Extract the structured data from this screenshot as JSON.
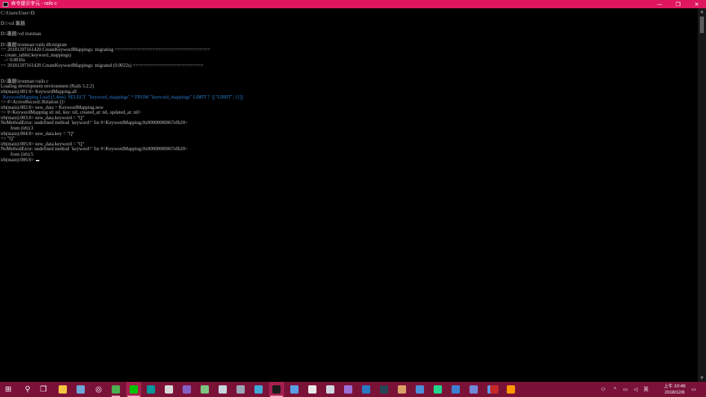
{
  "window": {
    "title": "命令提示字元 - rails  c",
    "controls": {
      "minimize": "—",
      "maximize": "❐",
      "close": "✕"
    }
  },
  "console": {
    "lines": [
      {
        "text": "C:\\Users\\User>D:"
      },
      {
        "text": ""
      },
      {
        "text": "D:\\>cd 專題"
      },
      {
        "text": ""
      },
      {
        "text": "D:\\專題>cd ironman"
      },
      {
        "text": ""
      },
      {
        "text": "D:\\專題\\ironman>rails db:migrate"
      },
      {
        "text": "== 20181207161420 CreateKeywordMappings: migrating ==================================="
      },
      {
        "text": "-- create_table(:keyword_mappings)"
      },
      {
        "text": "   -> 0.0016s"
      },
      {
        "text": "== 20181207161420 CreateKeywordMappings: migrated (0.0022s) =========================="
      },
      {
        "text": ""
      },
      {
        "text": ""
      },
      {
        "text": "D:\\專題\\ironman>rails c"
      },
      {
        "text": "Loading development environment (Rails 5.2.2)"
      },
      {
        "text": "irb(main):001:0> KeywordMapping.all"
      },
      {
        "text": "  KeywordMapping Load (1.4ms)  SELECT  \"keyword_mappings\".* FROM \"keyword_mappings\" LIMIT ?  [[\"LIMIT\", 11]]",
        "color": "blue"
      },
      {
        "text": "=> #<ActiveRecord::Relation []>"
      },
      {
        "text": "irb(main):002:0> new_data = KeywordMapping.new"
      },
      {
        "text": "=> #<KeywordMapping id: nil, key: nil, created_at: nil, updated_at: nil>"
      },
      {
        "text": "irb(main):003:0> new_data.keyword = \"Q\""
      },
      {
        "text": "NoMethodError: undefined method `keyword=' for #<KeywordMapping:0x00000000067efb20>"
      },
      {
        "text": "        from (irb):3"
      },
      {
        "text": "irb(main):004:0> new_data.key = \"Q\""
      },
      {
        "text": "=> \"Q\""
      },
      {
        "text": "irb(main):005:0> new_data.keyword = \"Q\""
      },
      {
        "text": "NoMethodError: undefined method `keyword=' for #<KeywordMapping:0x00000000067efb20>"
      },
      {
        "text": "        from (irb):5"
      },
      {
        "text": "irb(main):006:0> ",
        "cursor": true
      }
    ]
  },
  "taskbar": {
    "apps": [
      {
        "name": "start-icon",
        "glyph": "⊞",
        "color": "#ffffff",
        "bg": "transparent"
      },
      {
        "name": "search-icon",
        "glyph": "⚲",
        "color": "#ffffff",
        "bg": "transparent"
      },
      {
        "name": "task-view-icon",
        "glyph": "❐",
        "color": "#ffffff",
        "bg": "transparent"
      },
      {
        "name": "file-explorer-icon",
        "glyph": "",
        "color": "#f5c542",
        "bg": "#f5c542"
      },
      {
        "name": "app-blue-icon",
        "glyph": "",
        "color": "#6ea8d8",
        "bg": "#6ea8d8"
      },
      {
        "name": "app-target-icon",
        "glyph": "◎",
        "color": "#ffffff",
        "bg": "transparent"
      },
      {
        "name": "chrome-icon",
        "glyph": "",
        "color": "#4caf50",
        "bg": "#4caf50",
        "running": true
      },
      {
        "name": "line-icon",
        "glyph": "",
        "color": "#00c300",
        "bg": "#00c300",
        "active": true
      },
      {
        "name": "arduino-icon",
        "glyph": "",
        "color": "#00979d",
        "bg": "#00979d"
      },
      {
        "name": "image-viewer-icon",
        "glyph": "",
        "color": "#d8d8d8",
        "bg": "#d8d8d8"
      },
      {
        "name": "visual-studio-icon",
        "glyph": "",
        "color": "#865fc5",
        "bg": "#865fc5"
      },
      {
        "name": "app-green-house-icon",
        "glyph": "",
        "color": "#7cc47f",
        "bg": "#7cc47f"
      },
      {
        "name": "steam-icon",
        "glyph": "",
        "color": "#1b2838",
        "bg": "#c7d5e0"
      },
      {
        "name": "app-gear-icon",
        "glyph": "",
        "color": "#9ab",
        "bg": "#9aa8b8"
      },
      {
        "name": "app-cyan-icon",
        "glyph": "",
        "color": "#3fa9d6",
        "bg": "#3fa9d6"
      },
      {
        "name": "command-prompt-icon",
        "glyph": "",
        "color": "#111111",
        "bg": "#1a1a1a",
        "active": true
      },
      {
        "name": "app-lightblue-icon",
        "glyph": "",
        "color": "#5aa0e6",
        "bg": "#5aa0e6"
      },
      {
        "name": "app-white-icon",
        "glyph": "",
        "color": "#e8e8e8",
        "bg": "#e8e8e8"
      },
      {
        "name": "app-white2-icon",
        "glyph": "",
        "color": "#cfd8e0",
        "bg": "#cfd8e0"
      },
      {
        "name": "visual-studio-2-icon",
        "glyph": "",
        "color": "#9b6fd6",
        "bg": "#9b6fd6"
      },
      {
        "name": "app-blue2-icon",
        "glyph": "",
        "color": "#2b78c5",
        "bg": "#2b78c5"
      },
      {
        "name": "app-dark-icon",
        "glyph": "",
        "color": "#264653",
        "bg": "#264653"
      },
      {
        "name": "app-photo-icon",
        "glyph": "",
        "color": "#d9a066",
        "bg": "#d9a066"
      },
      {
        "name": "app-blue3-icon",
        "glyph": "",
        "color": "#4a90d9",
        "bg": "#4a90d9"
      },
      {
        "name": "pycharm-icon",
        "glyph": "",
        "color": "#21d789",
        "bg": "#21d789"
      },
      {
        "name": "app-blue4-icon",
        "glyph": "",
        "color": "#3c7fd1",
        "bg": "#3c7fd1"
      },
      {
        "name": "discord-icon",
        "glyph": "",
        "color": "#7289da",
        "bg": "#7289da"
      },
      {
        "name": "app-blue5-icon",
        "glyph": "",
        "color": "#5c9ce6",
        "bg": "#5c9ce6"
      },
      {
        "name": "app-red-icon",
        "glyph": "",
        "color": "#c62828",
        "bg": "#c62828"
      },
      {
        "name": "sublime-text-icon",
        "glyph": "",
        "color": "#ff9800",
        "bg": "#ff9800"
      }
    ],
    "tray": {
      "people": "⚇",
      "chevron": "^",
      "network": "▭",
      "volume": "◁",
      "ime": "英",
      "time": "上午 10:49",
      "date": "2018/12/8",
      "notification": "▭"
    }
  }
}
